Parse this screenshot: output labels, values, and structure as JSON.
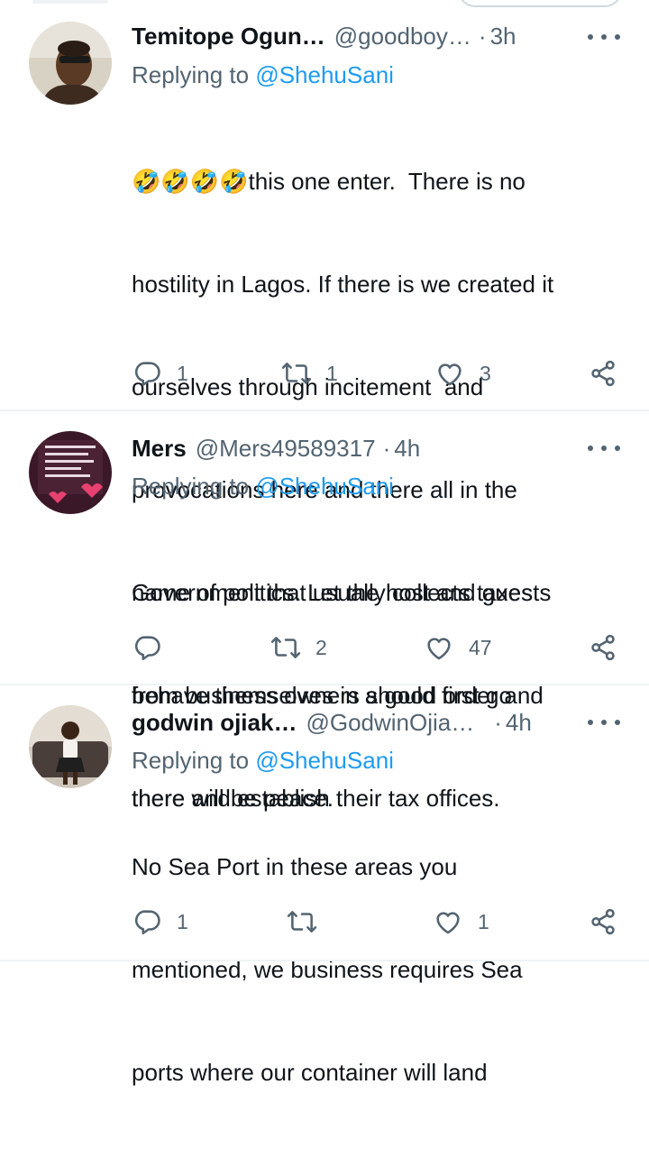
{
  "tweets": [
    {
      "name": "Temitope Ogun…",
      "handle": "@goodboy…",
      "time": "3h",
      "reply_prefix": "Replying to",
      "reply_mention": "@ShehuSani",
      "lines": [
        "this one enter.  There is no",
        "hostility in Lagos. If there is we created it",
        "ourselves through incitement  and",
        "provocations here and there all in the",
        "name of politics. Let the host and guests",
        "behave themselves in a good order and",
        "there will be peace."
      ],
      "emoji_prefix": "🤣🤣🤣🤣",
      "reply_count": "1",
      "retweet_count": "1",
      "like_count": "3"
    },
    {
      "name": "Mers",
      "handle": "@Mers49589317",
      "time": "4h",
      "reply_prefix": "Replying to",
      "reply_mention": "@ShehuSani",
      "lines": [
        "Government that usually collects taxes",
        "from business owners should first go",
        "there and establish their tax offices."
      ],
      "reply_count": "",
      "retweet_count": "2",
      "like_count": "47"
    },
    {
      "name": "godwin ojiak…",
      "handle": "@GodwinOjia…",
      "time": "4h",
      "reply_prefix": "Replying to",
      "reply_mention": "@ShehuSani",
      "lines": [
        "No Sea Port in these areas you",
        "mentioned, we business requires Sea",
        "ports where our container will land"
      ],
      "reply_count": "1",
      "retweet_count": "",
      "like_count": "1"
    }
  ],
  "icons": {
    "reply": "reply-icon",
    "retweet": "retweet-icon",
    "like": "heart-icon",
    "share": "share-icon",
    "more": "more-icon"
  },
  "colors": {
    "text": "#0f1419",
    "muted": "#536471",
    "link": "#1d9bf0",
    "divider": "#eff3f4"
  }
}
